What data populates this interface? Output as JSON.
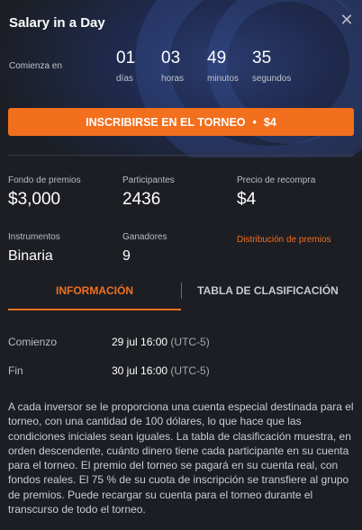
{
  "header": {
    "title": "Salary in a Day",
    "close_icon": "close-icon"
  },
  "countdown": {
    "label": "Comienza en",
    "units": [
      {
        "value": "01",
        "label": "días"
      },
      {
        "value": "03",
        "label": "horas"
      },
      {
        "value": "49",
        "label": "minutos"
      },
      {
        "value": "35",
        "label": "segundos"
      }
    ]
  },
  "cta": {
    "label": "INSCRIBIRSE EN EL TORNEO",
    "separator": "•",
    "price": "$4",
    "color": "#f26f1d"
  },
  "stats": {
    "prize_fund": {
      "label": "Fondo de premios",
      "value": "$3,000"
    },
    "participants": {
      "label": "Participantes",
      "value": "2436"
    },
    "rebuy_price": {
      "label": "Precio de recompra",
      "value": "$4"
    },
    "instruments": {
      "label": "Instrumentos",
      "value": "Binaria"
    },
    "winners": {
      "label": "Ganadores",
      "value": "9"
    },
    "prize_distribution_link": "Distribución de premios"
  },
  "tabs": [
    {
      "label": "INFORMACIÓN",
      "active": true
    },
    {
      "label": "TABLA DE CLASIFICACIÓN",
      "active": false
    }
  ],
  "info": {
    "start": {
      "label": "Comienzo",
      "date": "29 jul 16:00",
      "tz": "(UTC-5)"
    },
    "end": {
      "label": "Fin",
      "date": "30 jul 16:00",
      "tz": "(UTC-5)"
    },
    "description": "A cada inversor se le proporciona una cuenta especial destinada para el torneo, con una cantidad de 100 dólares, lo que hace que las condiciones iniciales sean iguales. La tabla de clasificación muestra, en orden descendente, cuánto dinero tiene cada participante en su cuenta para el torneo. El premio del torneo se pagará en su cuenta real, con fondos reales. El 75 % de su cuota de inscripción se transfiere al grupo de premios. Puede recargar su cuenta para el torneo durante el transcurso de todo el torneo."
  },
  "colors": {
    "accent": "#f26f1d",
    "background": "#1c1e24"
  }
}
